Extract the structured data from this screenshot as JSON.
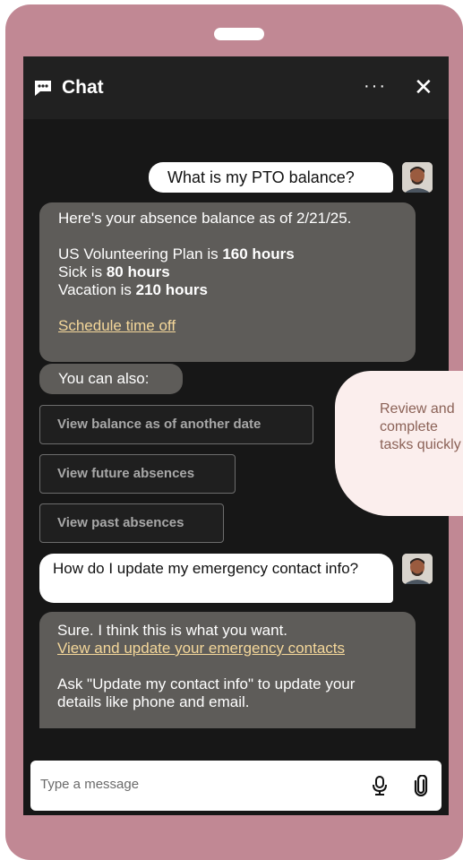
{
  "header": {
    "title": "Chat",
    "more": "···",
    "close": "✕"
  },
  "messages": {
    "user1": "What is my PTO balance?",
    "bot1": {
      "intro": "Here's your absence balance as of 2/21/25.",
      "line1_prefix": "US Volunteering Plan is ",
      "line1_value": "160 hours",
      "line2_prefix": "Sick is ",
      "line2_value": "80 hours",
      "line3_prefix": "Vacation is ",
      "line3_value": "210 hours",
      "link": "Schedule time off"
    },
    "also": "You can also:",
    "chips": [
      "View balance as of another date",
      "View future absences",
      "View past absences"
    ],
    "user2": "How do I update my emergency contact info?",
    "bot2": {
      "intro": "Sure. I think this is what you want.",
      "link": "View and update your emergency contacts",
      "tip": "Ask \"Update my contact info\" to update your details like phone and email."
    }
  },
  "input": {
    "placeholder": "Type a message"
  },
  "callout": {
    "text": "Review and\ncomplete\ntasks quickly"
  },
  "colors": {
    "frame": "#c18894",
    "screen": "#171717",
    "bot_bubble": "#5e5c59",
    "link": "#f4d79a",
    "callout": "#fbeeed"
  },
  "icons": [
    "chat-icon",
    "more-icon",
    "close-icon",
    "avatar-icon",
    "microphone-icon",
    "paperclip-icon"
  ]
}
